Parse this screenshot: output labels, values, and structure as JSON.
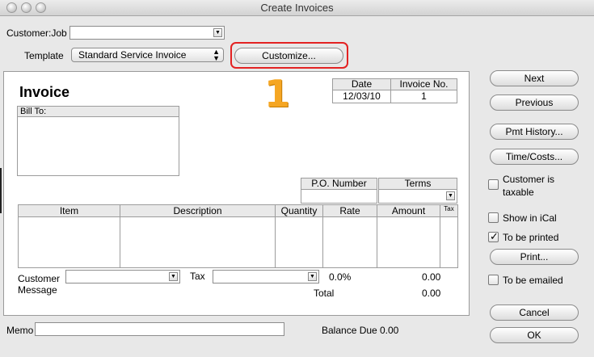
{
  "window": {
    "title": "Create Invoices"
  },
  "header": {
    "customer_job_label": "Customer:Job",
    "customer_job_value": "",
    "template_label": "Template",
    "template_value": "Standard Service Invoice",
    "customize_label": "Customize..."
  },
  "annotation": {
    "number": "1"
  },
  "invoice": {
    "title": "Invoice",
    "date_label": "Date",
    "date_value": "12/03/10",
    "invoice_no_label": "Invoice No.",
    "invoice_no_value": "1",
    "bill_to_label": "Bill To:",
    "po_number_label": "P.O. Number",
    "terms_label": "Terms",
    "columns": [
      "Item",
      "Description",
      "Quantity",
      "Rate",
      "Amount",
      "Tax"
    ],
    "customer_message_label_1": "Customer",
    "customer_message_label_2": "Message",
    "tax_label": "Tax",
    "tax_rate": "0.0%",
    "tax_amount": "0.00",
    "total_label": "Total",
    "total_value": "0.00"
  },
  "footer": {
    "memo_label": "Memo",
    "balance_due_label": "Balance Due",
    "balance_due_value": "0.00"
  },
  "side": {
    "next": "Next",
    "previous": "Previous",
    "pmt_history": "Pmt History...",
    "time_costs": "Time/Costs...",
    "customer_taxable_1": "Customer is",
    "customer_taxable_2": "taxable",
    "show_in_ical": "Show in iCal",
    "to_be_printed": "To be printed",
    "print": "Print...",
    "to_be_emailed": "To be emailed",
    "cancel": "Cancel",
    "ok": "OK"
  }
}
